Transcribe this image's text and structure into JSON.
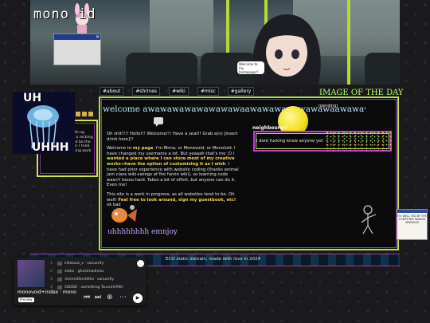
{
  "header": {
    "site_title": "mono    id",
    "speech_bubble": "Welcome to my homepage!!"
  },
  "nav": {
    "items": [
      "#about",
      "#shrines",
      "#wiki",
      "#misc",
      "#gallery"
    ]
  },
  "image_of_the_day": "IMAGE OF THE DAY",
  "left": {
    "top_text": "UH",
    "bottom_text": "UHHH",
    "side_text": "s bio ing with ng page. aded a rocking sprify kaland be the music player I tried doesnt fucking work"
  },
  "main": {
    "welcome": "welcome awawawawawawawawaawawawawawawawaawawawa",
    "pending": "(pending)",
    "paragraph1": "Oh shit!!!! Hello!!! Welcome!!! Have a seat!! Grab a(n) [insert drink here]!!",
    "paragraph2_a": "Welcome to ",
    "paragraph2_b": "my page",
    "paragraph2_c": ". I'm Mona, or Monovoid, or Monoloid. I have changed my username a lot. But yeaaah that's me :D I ",
    "paragraph2_d": "wanted a place where I can store most of my creative works+have the option of customizing it as I wish",
    "paragraph2_e": ". I have had prior experience with website coding (thanks animal jam clans wiki+wings of fire fanon wiki), so learning code wasn't toooo hard. Takes a bit of effort, but anyone can do it. Even me!",
    "paragraph3_a": "This site is a work in progress, as all websites tend to be. Oh well! ",
    "paragraph3_b": "Feel free to look around, sign my guestbook, etc!",
    "paragraph3_c": " ok baii",
    "signature": "uhhhhhhhh emnjoy"
  },
  "neighbours": {
    "label": "neighbours!!",
    "text": "i dont fucking know anyone yet"
  },
  "badge": {
    "text": "I'm WELL FED BY THE COMPUTER MAKING SPARKLES"
  },
  "footer": {
    "text": "ECO static domain, made with love in 2024"
  },
  "player": {
    "tracks": [
      {
        "n": "1",
        "title": "killakozz_x · sanuer0y"
      },
      {
        "n": "2",
        "title": "static · ghostmadness"
      },
      {
        "n": "3",
        "title": "mnmn00nn00hz · sanuer0y"
      },
      {
        "n": "4",
        "title": "SUDDZ · something Tsurumi(Mit)"
      }
    ],
    "name": "monovoid+index · mono",
    "preview": "Preview"
  },
  "colors": {
    "accent_green": "#b6e24a",
    "accent_purple": "#9c3bb0",
    "welcome_blue": "#b9e7ff",
    "highlight_yellow": "#f3d34a"
  }
}
